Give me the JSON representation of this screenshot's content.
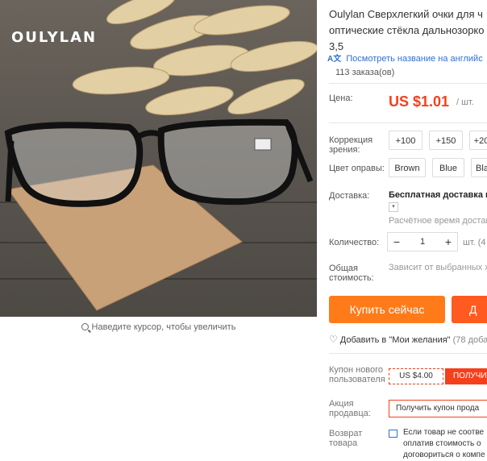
{
  "image": {
    "brand_text": "OULYLAN",
    "zoom_hint": "Наведите курсор, чтобы увеличить"
  },
  "product": {
    "title_line1": "Oulylan Сверхлегкий очки для ч",
    "title_line2": "оптические стёкла дальнозорко",
    "title_line3": "3,5",
    "translate_link": "Посмотреть название на английс",
    "translate_icon": "translate-icon",
    "orders": "113 заказа(ов)"
  },
  "price": {
    "label": "Цена:",
    "value": "US $1.01",
    "unit": "/ шт."
  },
  "options": {
    "diopter_label": "Коррекция зрения:",
    "diopters": [
      "+100",
      "+150",
      "+20"
    ],
    "color_label": "Цвет оправы:",
    "colors": [
      "Brown",
      "Blue",
      "Bla"
    ]
  },
  "shipping": {
    "label": "Доставка:",
    "value": "Бесплатная доставка в",
    "estimate": "Расчётное время доставки"
  },
  "quantity": {
    "label": "Количество:",
    "minus": "−",
    "value": "1",
    "plus": "+",
    "unit": "шт. (4"
  },
  "total": {
    "label": "Общая стоимость:",
    "value": "Зависит от выбранных х"
  },
  "actions": {
    "buy_now": "Купить сейчас",
    "add_to_cart": "Д",
    "wishlist": "Добавить в \"Мои желания\"",
    "wishlist_count": "(78 доба"
  },
  "coupons": {
    "new_user_label": "Купон нового пользователя",
    "new_user_amount": "US $4.00",
    "new_user_button": "ПОЛУЧИ",
    "seller_label": "Акция продавца:",
    "seller_button": "Получить купон прода"
  },
  "returns": {
    "label": "Возврат товара",
    "text_line1": "Если товар не соотве",
    "text_line2": "оплатив стоимость о",
    "text_line3": "договориться о компе"
  },
  "colors": {
    "accent_orange": "#ff7b1a",
    "price_red": "#f5401b",
    "link_blue": "#2f6fd6"
  }
}
